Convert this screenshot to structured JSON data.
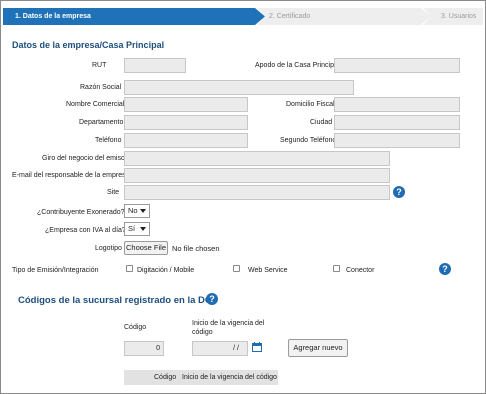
{
  "steps": [
    {
      "label": "1. Datos de la empresa"
    },
    {
      "label": "2. Certificado"
    },
    {
      "label": "3. Usuarios"
    }
  ],
  "company_section": {
    "title": "Datos de la empresa/Casa Principal",
    "fields": {
      "rut": {
        "label": "RUT",
        "value": ""
      },
      "apodo": {
        "label": "Apodo de la Casa Principal",
        "value": ""
      },
      "razon_social": {
        "label": "Razón Social",
        "value": ""
      },
      "nombre_comercial": {
        "label": "Nombre Comercial",
        "value": ""
      },
      "domicilio_fiscal": {
        "label": "Domicilio Fiscal",
        "value": ""
      },
      "departamento": {
        "label": "Departamento",
        "value": ""
      },
      "ciudad": {
        "label": "Ciudad",
        "value": ""
      },
      "telefono": {
        "label": "Teléfono",
        "value": ""
      },
      "segundo_telefono": {
        "label": "Segundo Teléfono",
        "value": ""
      },
      "giro": {
        "label": "Giro del negocio del emisor",
        "value": ""
      },
      "email": {
        "label": "E-mail del responsable de la empresa",
        "value": ""
      },
      "site": {
        "label": "Site",
        "value": ""
      }
    },
    "contribuyente_exonerado": {
      "label": "¿Contribuyente Exonerado?",
      "selected": "No"
    },
    "empresa_iva": {
      "label": "¿Empresa con IVA al día?",
      "selected": "Sí"
    },
    "logotipo": {
      "label": "Logotipo",
      "button": "Choose File",
      "status": "No file chosen"
    },
    "emision": {
      "label": "Tipo de Emisión/Integración",
      "options": [
        {
          "label": "Digitación / Mobile"
        },
        {
          "label": "Web Service"
        },
        {
          "label": "Conector"
        }
      ]
    }
  },
  "branch_section": {
    "title": "Códigos de la sucursal registrado en la DGI",
    "codigo_label": "Código",
    "codigo_value": "0",
    "vigencia_label_1": "Inicio de la vigencia del",
    "vigencia_label_2": "código",
    "vigencia_value": "/ /",
    "add_button": "Agregar nuevo",
    "table_headers": [
      "Código",
      "Inicio de la vigencia del código"
    ]
  },
  "help_icon_glyph": "?",
  "colors": {
    "accent": "#1f72b8",
    "section_title": "#1d4e7e",
    "help": "#1f6cb3"
  }
}
